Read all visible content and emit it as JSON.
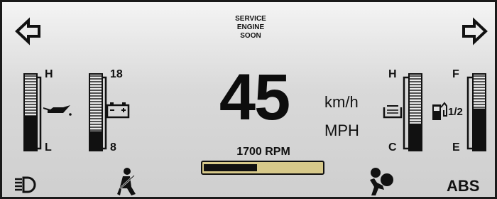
{
  "warning": {
    "line1": "SERVICE",
    "line2": "ENGINE",
    "line3": "SOON"
  },
  "speed": {
    "value": "45",
    "unit_metric": "km/h",
    "unit_imperial": "MPH"
  },
  "rpm": {
    "label": "1700 RPM",
    "fill_fraction": 0.45
  },
  "gauges": {
    "oil_temp": {
      "high": "H",
      "low": "L",
      "level_fraction": 0.45,
      "icon": "oil-can-icon"
    },
    "battery": {
      "high": "18",
      "low": "8",
      "level_fraction": 0.25,
      "icon": "battery-icon"
    },
    "coolant_temp": {
      "high": "H",
      "low": "C",
      "level_fraction": 0.35,
      "icon": "coolant-icon"
    },
    "fuel": {
      "high": "F",
      "low": "E",
      "mid": "1/2",
      "level_fraction": 0.55,
      "icon": "fuel-pump-icon"
    }
  },
  "indicators": {
    "abs": "ABS",
    "left_turn": "left-turn-arrow-icon",
    "right_turn": "right-turn-arrow-icon",
    "headlight": "headlight-icon",
    "seatbelt": "seatbelt-icon",
    "airbag": "airbag-icon"
  },
  "colors": {
    "bar_fill": "#111111",
    "rpm_track": "#d7c98a",
    "background": "#d9d9d9"
  }
}
